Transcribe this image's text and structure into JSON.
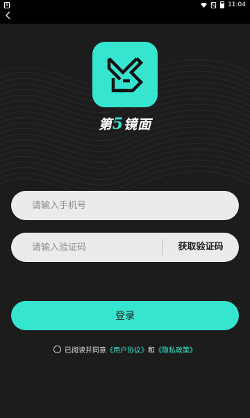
{
  "status_bar": {
    "time": "11:04",
    "notification_icon": "A"
  },
  "logo": {
    "text_prefix": "第",
    "text_number": "5",
    "text_suffix": "镜面",
    "accent_color": "#36e5cf"
  },
  "form": {
    "phone_placeholder": "请输入手机号",
    "code_placeholder": "请输入验证码",
    "get_code_label": "获取验证码",
    "login_label": "登录"
  },
  "agreement": {
    "prefix": "已阅读并同意",
    "user_agreement": "《用户协议》",
    "and": "和",
    "privacy_policy": "《隐私政策》"
  }
}
